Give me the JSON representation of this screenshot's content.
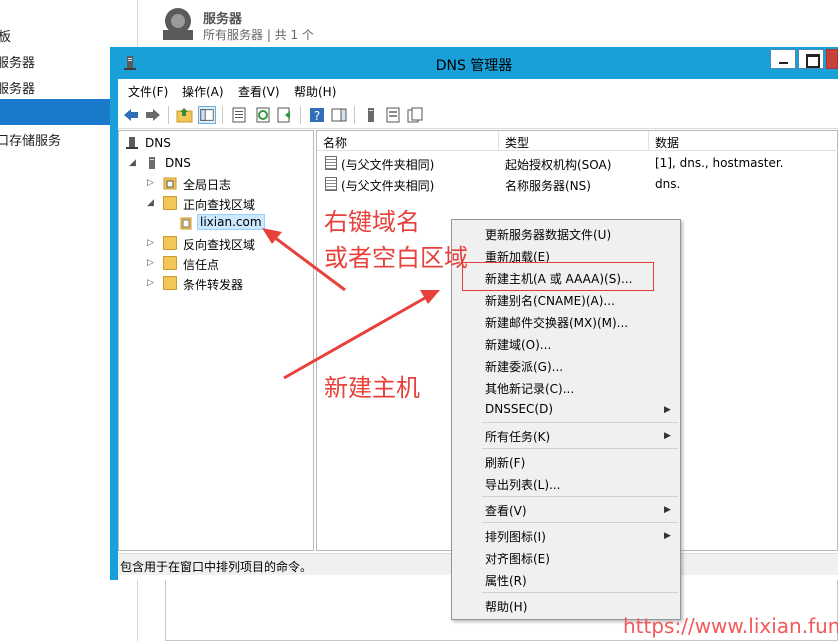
{
  "background": {
    "sidebar_items": [
      "板",
      "服务器",
      "服务器",
      "口存储服务"
    ],
    "header_title": "服务器",
    "header_subtitle": "所有服务器 | 共 1 个"
  },
  "window": {
    "title": "DNS 管理器",
    "menu": [
      "文件(F)",
      "操作(A)",
      "查看(V)",
      "帮助(H)"
    ],
    "status": "包含用于在窗口中排列项目的命令。"
  },
  "tree": {
    "root": "DNS",
    "server": "DNS",
    "items": [
      {
        "label": "全局日志"
      },
      {
        "label": "正向查找区域"
      },
      {
        "label": "lixian.com"
      },
      {
        "label": "反向查找区域"
      },
      {
        "label": "信任点"
      },
      {
        "label": "条件转发器"
      }
    ]
  },
  "list": {
    "columns": [
      "名称",
      "类型",
      "数据"
    ],
    "rows": [
      {
        "name": "(与父文件夹相同)",
        "type": "起始授权机构(SOA)",
        "data": "[1], dns., hostmaster."
      },
      {
        "name": "(与父文件夹相同)",
        "type": "名称服务器(NS)",
        "data": "dns."
      }
    ]
  },
  "context_menu": {
    "items": [
      "更新服务器数据文件(U)",
      "重新加载(E)",
      "新建主机(A 或 AAAA)(S)...",
      "新建别名(CNAME)(A)...",
      "新建邮件交换器(MX)(M)...",
      "新建域(O)...",
      "新建委派(G)...",
      "其他新记录(C)...",
      "DNSSEC(D)",
      "所有任务(K)",
      "刷新(F)",
      "导出列表(L)...",
      "查看(V)",
      "排列图标(I)",
      "对齐图标(E)",
      "属性(R)",
      "帮助(H)"
    ]
  },
  "annotations": {
    "line1": "右键域名",
    "line2": "或者空白区域",
    "line3": "新建主机",
    "watermark": "https://www.lixian.fun"
  },
  "colors": {
    "titlebar": "#1aa0d8",
    "annotation": "#e8413b",
    "selection": "#1979ca"
  }
}
